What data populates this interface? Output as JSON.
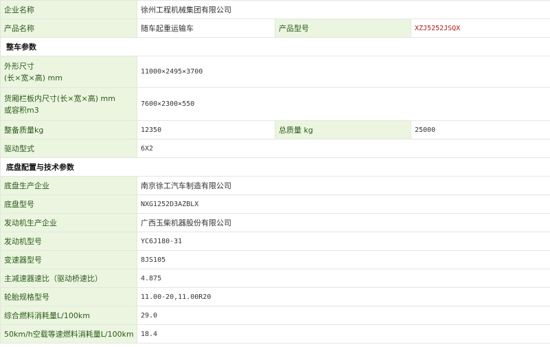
{
  "company": {
    "label": "企业名称",
    "value": "徐州工程机械集团有限公司"
  },
  "product": {
    "label": "产品名称",
    "value": "随车起重运输车",
    "model_label": "产品型号",
    "model_value": "XZJ5252JSQX"
  },
  "sections": {
    "vehicle": "整车参数",
    "chassis": "底盘配置与技术参数"
  },
  "dims": {
    "label_line1": "外形尺寸",
    "label_line2": "(长×宽×高) mm",
    "value": "11000×2495×3700"
  },
  "cargo": {
    "label_line1": "货厢栏板内尺寸(长×宽×高) mm",
    "label_line2": "或容积m3",
    "value": "7600×2300×550"
  },
  "mass": {
    "label": "整备质量kg",
    "value": "12350",
    "total_label": "总质量 kg",
    "total_value": "25000"
  },
  "drive": {
    "label": "驱动型式",
    "value": "6X2"
  },
  "chassis_rows": [
    {
      "label": "底盘生产企业",
      "value": "南京徐工汽车制造有限公司"
    },
    {
      "label": "底盘型号",
      "value": "NXG1252D3AZBLX"
    },
    {
      "label": "发动机生产企业",
      "value": "广西玉柴机器股份有限公司"
    },
    {
      "label": "发动机型号",
      "value": "YC6J180-31"
    },
    {
      "label": "变速器型号",
      "value": "8JS105"
    },
    {
      "label": "主减速器速比（驱动桥速比）",
      "value": "4.875"
    },
    {
      "label": "轮胎规格型号",
      "value": "11.00-20,11.00R20"
    },
    {
      "label": "综合燃料消耗量L/100km",
      "value": "29.0"
    },
    {
      "label": "50km/h空载等速燃料消耗量L/100km",
      "value": "18.4"
    }
  ]
}
